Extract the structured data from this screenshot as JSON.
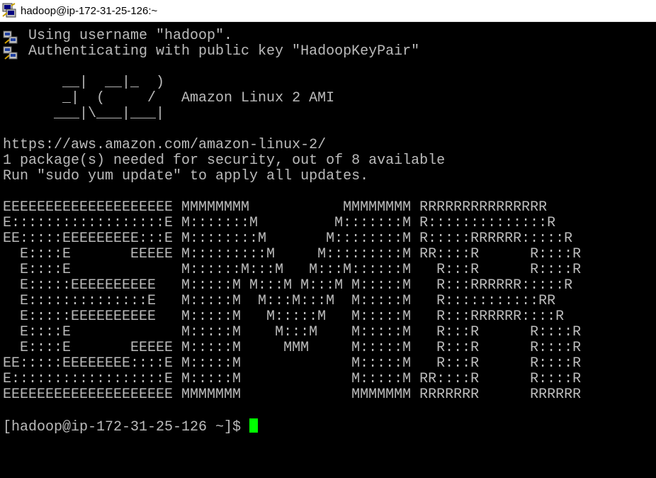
{
  "window": {
    "title": "hadoop@ip-172-31-25-126:~"
  },
  "icons": {
    "app": "putty-terminal-icon",
    "line": "putty-network-icon"
  },
  "terminal": {
    "login_lines": [
      "Using username \"hadoop\".",
      "Authenticating with public key \"HadoopKeyPair\""
    ],
    "ami_banner": "       __|  __|_  )\n       _|  (     /   Amazon Linux 2 AMI\n      ___|\\___|___|",
    "info_lines": "https://aws.amazon.com/amazon-linux-2/\n1 package(s) needed for security, out of 8 available\nRun \"sudo yum update\" to apply all updates.",
    "emr_banner": "EEEEEEEEEEEEEEEEEEEE MMMMMMMM           MMMMMMMM RRRRRRRRRRRRRRR\nE::::::::::::::::::E M:::::::M         M:::::::M R::::::::::::::R\nEE:::::EEEEEEEEE:::E M::::::::M       M::::::::M R:::::RRRRRR:::::R\n  E::::E       EEEEE M:::::::::M     M:::::::::M RR::::R      R::::R\n  E::::E             M::::::M:::M   M:::M::::::M   R:::R      R::::R\n  E:::::EEEEEEEEEE   M:::::M M:::M M:::M M:::::M   R:::RRRRRR:::::R\n  E::::::::::::::E   M:::::M  M:::M:::M  M:::::M   R:::::::::::RR\n  E:::::EEEEEEEEEE   M:::::M   M:::::M   M:::::M   R:::RRRRRR::::R\n  E::::E             M:::::M    M:::M    M:::::M   R:::R      R::::R\n  E::::E       EEEEE M:::::M     MMM     M:::::M   R:::R      R::::R\nEE:::::EEEEEEEE::::E M:::::M             M:::::M   R:::R      R::::R\nE::::::::::::::::::E M:::::M             M:::::M RR::::R      R::::R\nEEEEEEEEEEEEEEEEEEEE MMMMMMM             MMMMMMM RRRRRRR      RRRRRR",
    "prompt": "[hadoop@ip-172-31-25-126 ~]$ ",
    "colors": {
      "background": "#000000",
      "text": "#bbbbbb",
      "cursor": "#00ff00"
    }
  }
}
